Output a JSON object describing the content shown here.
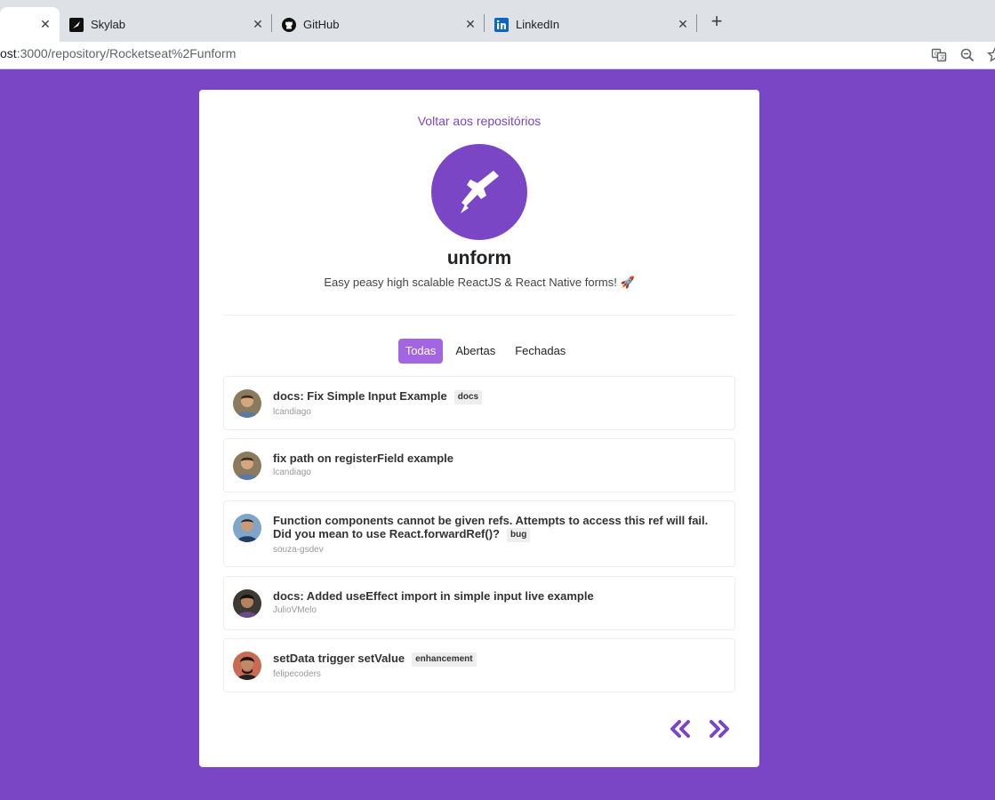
{
  "browser": {
    "tabs": [
      {
        "title": "",
        "active": true
      },
      {
        "title": "Skylab",
        "active": false
      },
      {
        "title": "GitHub",
        "active": false
      },
      {
        "title": "LinkedIn",
        "active": false
      }
    ],
    "new_tab": "+",
    "close_glyph": "✕",
    "url_visible_prefix": "ost",
    "url_rest": ":3000/repository/Rocketseat%2Funform"
  },
  "page": {
    "back_link": "Voltar aos repositórios",
    "repo_name": "unform",
    "repo_description": "Easy peasy high scalable ReactJS & React Native forms! 🚀",
    "filters": [
      {
        "label": "Todas",
        "active": true
      },
      {
        "label": "Abertas",
        "active": false
      },
      {
        "label": "Fechadas",
        "active": false
      }
    ],
    "issues": [
      {
        "title": "docs: Fix Simple Input Example",
        "labels": [
          "docs"
        ],
        "author": "lcandiago"
      },
      {
        "title": "fix path on registerField example",
        "labels": [],
        "author": "lcandiago"
      },
      {
        "title": "Function components cannot be given refs. Attempts to access this ref will fail. Did you mean to use React.forwardRef()?",
        "labels": [
          "bug"
        ],
        "author": "souza-gsdev"
      },
      {
        "title": "docs: Added useEffect import in simple input live example",
        "labels": [],
        "author": "JulioVMelo"
      },
      {
        "title": "setData trigger setValue",
        "labels": [
          "enhancement"
        ],
        "author": "felipecoders"
      }
    ],
    "pager": {
      "prev_icon": "double-chevron-left-icon",
      "next_icon": "double-chevron-right-icon"
    }
  },
  "colors": {
    "background": "#7b46c6",
    "accent": "#7b46c6",
    "active_filter": "#a465e3",
    "card": "#ffffff"
  }
}
